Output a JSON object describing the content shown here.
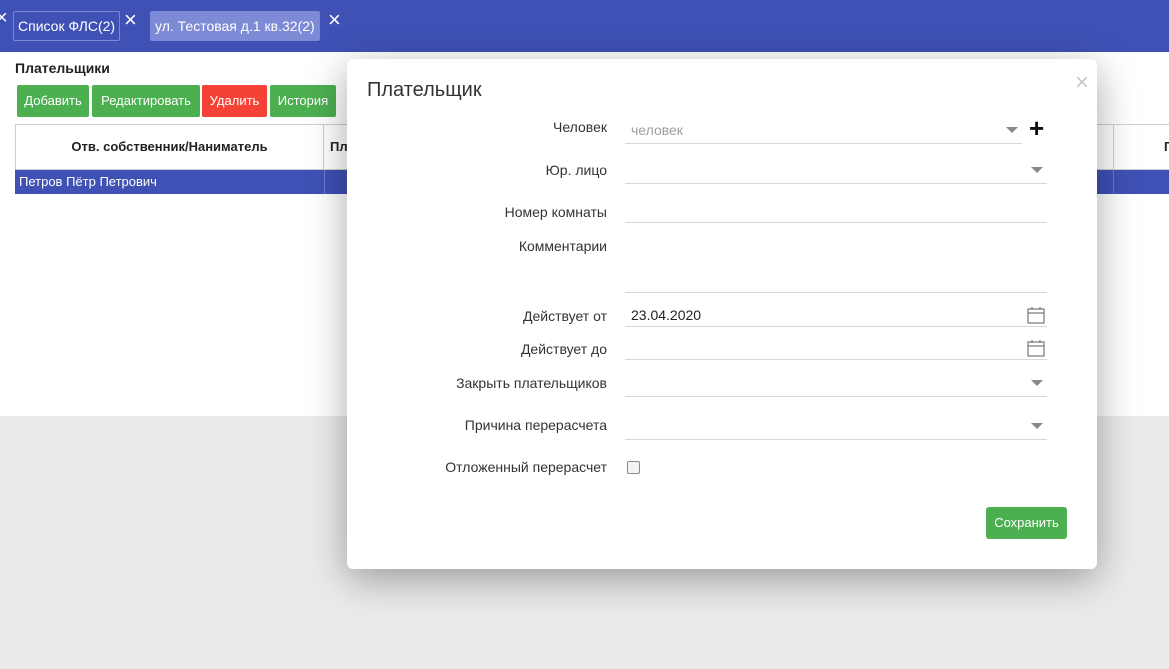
{
  "tabs": [
    {
      "label": "Список ФЛС(2)"
    },
    {
      "label": "ул. Тестовая д.1 кв.32(2)"
    }
  ],
  "page": {
    "section_title": "Плательщики",
    "toolbar": {
      "add": "Добавить",
      "edit": "Редактировать",
      "delete": "Удалить",
      "history": "История"
    },
    "grid": {
      "columns": [
        "Отв. собственник/Наниматель",
        "Пл",
        "П"
      ],
      "rows": [
        {
          "owner": "Петров Пётр Петрович"
        }
      ]
    }
  },
  "dialog": {
    "title": "Плательщик",
    "fields": {
      "person": {
        "label": "Человек",
        "placeholder": "человек"
      },
      "legal": {
        "label": "Юр. лицо",
        "value": ""
      },
      "room": {
        "label": "Номер комнаты",
        "value": ""
      },
      "comments": {
        "label": "Комментарии",
        "value": ""
      },
      "from": {
        "label": "Действует от",
        "value": "23.04.2020"
      },
      "to": {
        "label": "Действует до",
        "value": ""
      },
      "close_payers": {
        "label": "Закрыть плательщиков",
        "value": ""
      },
      "reason": {
        "label": "Причина перерасчета",
        "value": ""
      },
      "deferred": {
        "label": "Отложенный перерасчет",
        "checked": false
      }
    },
    "save_label": "Сохранить"
  },
  "colors": {
    "header": "#3f51b5",
    "green": "#4caf50",
    "red": "#f44336",
    "selected_row": "#3f51b5"
  },
  "icons": [
    "close-icon",
    "plus-icon",
    "calendar-icon",
    "chevron-down-icon"
  ]
}
